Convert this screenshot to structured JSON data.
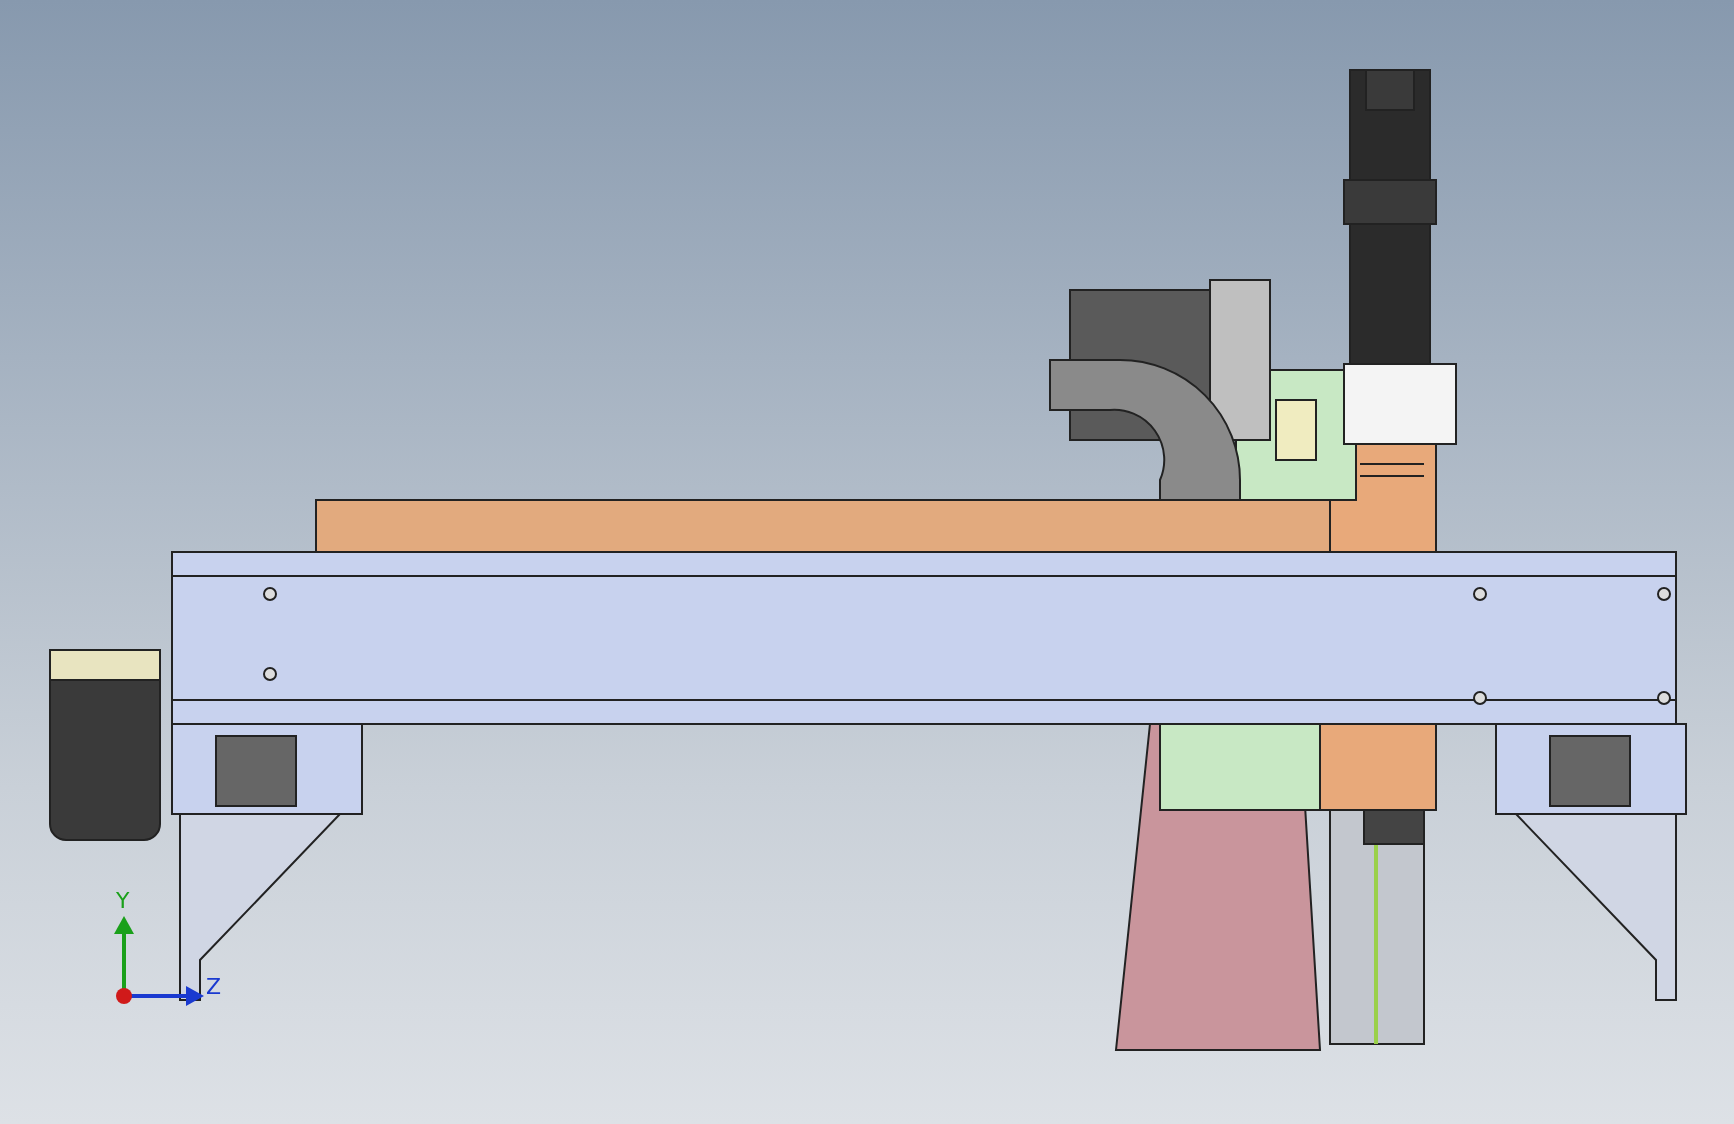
{
  "axis_triad": {
    "y_label": "Y",
    "z_label": "Z"
  }
}
